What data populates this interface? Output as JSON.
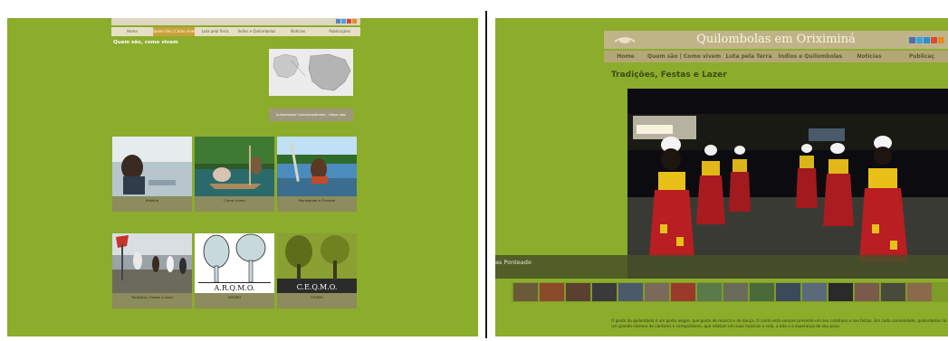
{
  "left": {
    "nav": [
      "Home",
      "Quem são | Como vivem",
      "Luta pela Terra",
      "Índios e Quilombolas",
      "Notícias",
      "Publicações"
    ],
    "nav_active_index": 1,
    "heading": "Quem são, como vivem",
    "map_button": "Quilombolas Contemporâneos - clique aqui",
    "tiles": [
      {
        "label": "História"
      },
      {
        "label": "Como vivem"
      },
      {
        "label": "Manejando a Floresta"
      },
      {
        "label": "Tradições, Festas e lazer"
      },
      {
        "label": "ARQMO"
      },
      {
        "label": "CEQMO"
      }
    ],
    "arqmo_text": "A.R.Q.M.O.",
    "ceqmo_text": "C.E.Q.M.O."
  },
  "right": {
    "site_title": "Quilombolas em Oriximiná",
    "nav": [
      "Home",
      "Quem são | Como vivem",
      "Luta pela Terra",
      "Índios e Quilombolas",
      "Notícias",
      "Publicaç"
    ],
    "heading": "Tradições, Festas e Lazer",
    "caption": "as Ponteado",
    "description": "O gosto do quilombola é um gosto alegre, que gosta de música e de dança. O canto está sempre presente em seu cotidiano e nas festas. Em cada comunidade, quilombolas há um grande número de cantores e compositores, que relatam em suas músicas a vida, a luta e a esperança do seu povo."
  },
  "colors": {
    "page_green": "#8cac2c",
    "nav_beige": "#b4a777",
    "active_gold": "#c9a03a"
  }
}
